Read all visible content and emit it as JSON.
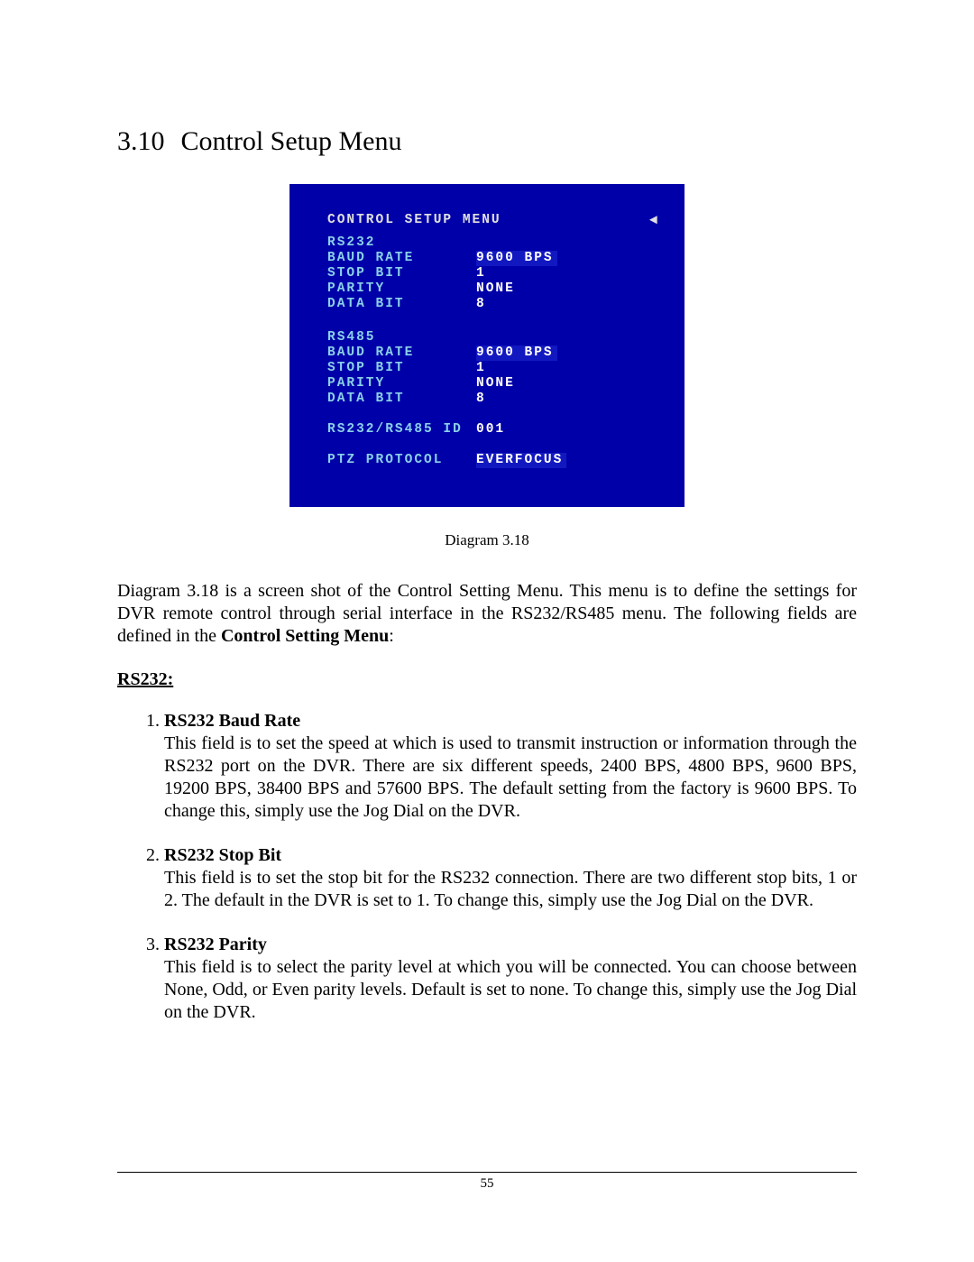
{
  "heading": {
    "number": "3.10",
    "title": "Control Setup Menu"
  },
  "crt": {
    "title": "CONTROL SETUP MENU",
    "arrow": "◄",
    "rs232": {
      "header": "RS232",
      "baud": {
        "label": "BAUD RATE",
        "value": "9600 BPS"
      },
      "stop": {
        "label": "STOP BIT",
        "value": "1"
      },
      "parity": {
        "label": "PARITY",
        "value": "NONE"
      },
      "databit": {
        "label": "DATA BIT",
        "value": "8"
      }
    },
    "rs485": {
      "header": "RS485",
      "baud": {
        "label": "BAUD RATE",
        "value": "9600 BPS"
      },
      "stop": {
        "label": "STOP BIT",
        "value": "1"
      },
      "parity": {
        "label": "PARITY",
        "value": "NONE"
      },
      "databit": {
        "label": "DATA BIT",
        "value": "8"
      }
    },
    "id": {
      "label": "RS232/RS485 ID",
      "value": "001"
    },
    "ptz": {
      "label": "PTZ PROTOCOL",
      "value": "EVERFOCUS"
    }
  },
  "caption": "Diagram 3.18",
  "intro": {
    "text1": "Diagram 3.18 is a screen shot of the Control Setting Menu. This menu is to define the settings for DVR remote control through serial interface in the RS232/RS485 menu. The following fields are defined in the ",
    "bold": "Control Setting Menu",
    "text2": ":"
  },
  "subhead": "RS232:",
  "items": [
    {
      "name": "RS232 Baud Rate",
      "desc": "This field is to set the speed at which is used to transmit instruction or information through the RS232 port on the DVR. There are six different speeds, 2400 BPS, 4800 BPS, 9600 BPS, 19200 BPS, 38400 BPS and 57600 BPS. The default setting from the factory is 9600 BPS. To change this, simply use the Jog Dial on the DVR."
    },
    {
      "name": "RS232 Stop Bit",
      "desc": "This field is to set the stop bit for the RS232 connection. There are two different stop bits, 1 or 2. The default in the DVR is set to 1. To change this, simply use the Jog Dial on the DVR."
    },
    {
      "name": "RS232 Parity",
      "desc": "This field is to select the parity level at which you will be connected. You can choose between None, Odd, or Even parity levels. Default is set to none. To change this, simply use the Jog Dial on the DVR."
    }
  ],
  "pageNumber": "55"
}
